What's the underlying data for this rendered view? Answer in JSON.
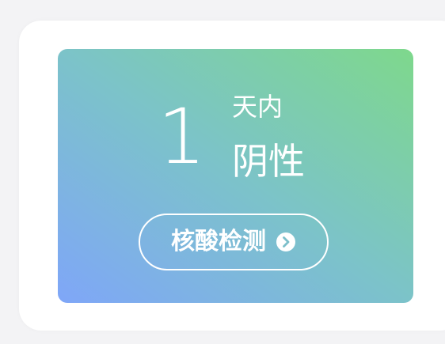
{
  "status_card": {
    "days_number": "1",
    "days_unit": "天内",
    "result": "阴性",
    "button_label": "核酸检测",
    "button_icon": "chevron-right-circle-icon",
    "gradient_colors": [
      "#7fa6f8",
      "#7cc3c9",
      "#7ed88c"
    ]
  }
}
